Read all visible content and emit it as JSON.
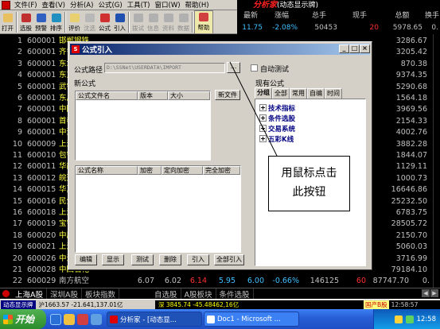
{
  "menubar": {
    "items": [
      "文件(F)",
      "查看(V)",
      "分析(A)",
      "公式(G)",
      "工具(T)",
      "窗口(W)",
      "帮助(H)"
    ],
    "brand": "分析家",
    "brand_suffix": "(动态显示牌)"
  },
  "toolbar": {
    "buttons": [
      "打开",
      "选股",
      "预警",
      "排序",
      "评价",
      "沈选",
      "公式",
      "引入",
      "拨试",
      "信息",
      "资料",
      "数据",
      "帮助"
    ]
  },
  "quote": {
    "headers": [
      "最新",
      "涨幅",
      "总手",
      "现手",
      "总额",
      "换手"
    ],
    "top_row": {
      "latest": "11.75",
      "change": "-2.08%",
      "total": "50453",
      "current": "20",
      "amount": "5978.65",
      "turnover": "0."
    }
  },
  "stocks": [
    {
      "num": "1",
      "code": "600001",
      "name": "邯郸钢铁",
      "right": "3286.67"
    },
    {
      "num": "2",
      "code": "600001",
      "name": "齐鲁石化",
      "right": "3205.42"
    },
    {
      "num": "3",
      "code": "600001",
      "name": "东北高速",
      "right": "870.38"
    },
    {
      "num": "4",
      "code": "600001",
      "name": "东方电子",
      "right": "9374.35"
    },
    {
      "num": "5",
      "code": "600001",
      "name": "武钢股份",
      "right": "5290.68"
    },
    {
      "num": "6",
      "code": "600001",
      "name": "东风汽车",
      "right": "1564.18"
    },
    {
      "num": "7",
      "code": "600001",
      "name": "中国国贸",
      "right": "3969.56"
    },
    {
      "num": "8",
      "code": "600001",
      "name": "首都机场",
      "right": "2154.33"
    },
    {
      "num": "9",
      "code": "600001",
      "name": "中远发展",
      "right": "4002.76"
    },
    {
      "num": "10",
      "code": "600009",
      "name": "上海机场",
      "right": "3882.28"
    },
    {
      "num": "11",
      "code": "600010",
      "name": "包钢股份",
      "right": "1844.07"
    },
    {
      "num": "12",
      "code": "600011",
      "name": "华能国际",
      "right": "1129.11"
    },
    {
      "num": "13",
      "code": "600012",
      "name": "皖通高速",
      "right": "1000.73"
    },
    {
      "num": "14",
      "code": "600015",
      "name": "华夏银行",
      "right": "16646.86"
    },
    {
      "num": "15",
      "code": "600016",
      "name": "民生银行",
      "right": "25232.50"
    },
    {
      "num": "16",
      "code": "600018",
      "name": "上港集团",
      "right": "6783.75"
    },
    {
      "num": "17",
      "code": "600019",
      "name": "宝钢股份",
      "right": "28505.72"
    },
    {
      "num": "18",
      "code": "600020",
      "name": "中原高速",
      "right": "2150.70"
    },
    {
      "num": "19",
      "code": "600021",
      "name": "上海电力",
      "right": "5060.03"
    },
    {
      "num": "20",
      "code": "600026",
      "name": "中海发展",
      "right": "3716.99"
    },
    {
      "num": "21",
      "code": "600028",
      "name": "中国石化",
      "right": "79184.10"
    }
  ],
  "last_row": {
    "num": "22",
    "code": "600029",
    "name": "南方航空",
    "v1": "6.07",
    "v2": "6.02",
    "v3": "6.14",
    "v4": "5.95",
    "v5": "6.00",
    "v6": "-0.66%",
    "v7": "146125",
    "v8": "60",
    "v9": "87747.70",
    "v10": "0."
  },
  "tabs": [
    "上海A股",
    "深圳A股",
    "板块指数",
    "自选股",
    "A股板块",
    "条件选股"
  ],
  "status": {
    "app": "动态显示牌",
    "index_text": "沪1663.57 -21.641,137.01亿",
    "scroll_text": "深 3845.74 -45.48462,16亿",
    "link": "国产B股",
    "time": "12:58:57"
  },
  "taskbar": {
    "start": "开始",
    "items": [
      "分析家 - [动态显...",
      "Doc1 - Microsoft ..."
    ],
    "clock": "12:58"
  },
  "dialog": {
    "title": "公式引入",
    "path_label": "公式路径",
    "path_value": "D:\\SSNet\\USERDATA\\IMPORT",
    "browse": "...",
    "auto_test": "自动测试",
    "new_formula": "新公式",
    "file_list_headers": [
      "公式文件名",
      "版本",
      "大小"
    ],
    "new_file_button": "新文件",
    "name_list_headers": [
      "公式名称",
      "加密",
      "定向加密",
      "完全加密"
    ],
    "buttons": [
      "编辑",
      "显示",
      "测试",
      "删除",
      "引入",
      "全部引入"
    ],
    "existing_label": "现有公式",
    "existing_tabs": [
      "分组",
      "全部",
      "常用",
      "自编",
      "时间"
    ],
    "tree": [
      "技术指标",
      "条件选股",
      "交易系统",
      "五彩K线"
    ]
  },
  "callout": {
    "line1": "用鼠标点击",
    "line2": "此按钮"
  }
}
